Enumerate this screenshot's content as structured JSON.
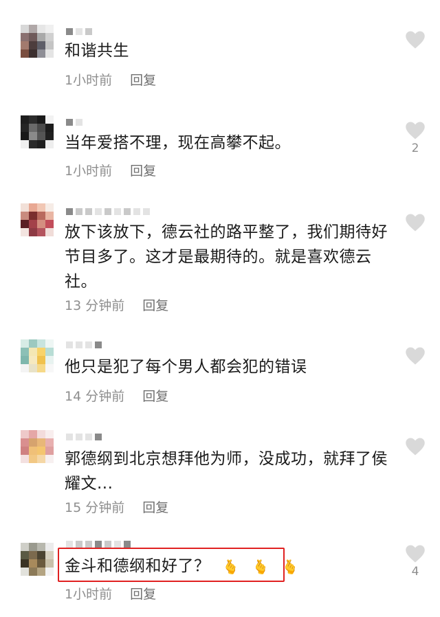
{
  "comments": [
    {
      "text": "和谐共生",
      "time": "1小时前",
      "reply": "回复",
      "likes": ""
    },
    {
      "text": "当年爱搭不理，现在高攀不起。",
      "time": "1小时前",
      "reply": "回复",
      "likes": "2"
    },
    {
      "text": "放下该放下，德云社的路平整了，我们期待好节目多了。这才是最期待的。就是喜欢德云社。",
      "time": "13 分钟前",
      "reply": "回复",
      "likes": ""
    },
    {
      "text": "他只是犯了每个男人都会犯的错误",
      "time": "14 分钟前",
      "reply": "回复",
      "likes": ""
    },
    {
      "text": "郭德纲到北京想拜他为师，没成功，就拜了侯耀文...",
      "time": "15 分钟前",
      "reply": "回复",
      "likes": ""
    },
    {
      "text": "金斗和德纲和好了？",
      "emojis": [
        "🫰",
        "🫰",
        "🫰"
      ],
      "time": "1小时前",
      "reply": "回复",
      "likes": "4"
    }
  ],
  "icons": {
    "like": "heart-icon",
    "emoji": "finger-heart-emoji"
  },
  "colors": {
    "highlight_border": "#e02020",
    "meta_text": "#8e8e8e",
    "heart": "#d9d9d9"
  }
}
